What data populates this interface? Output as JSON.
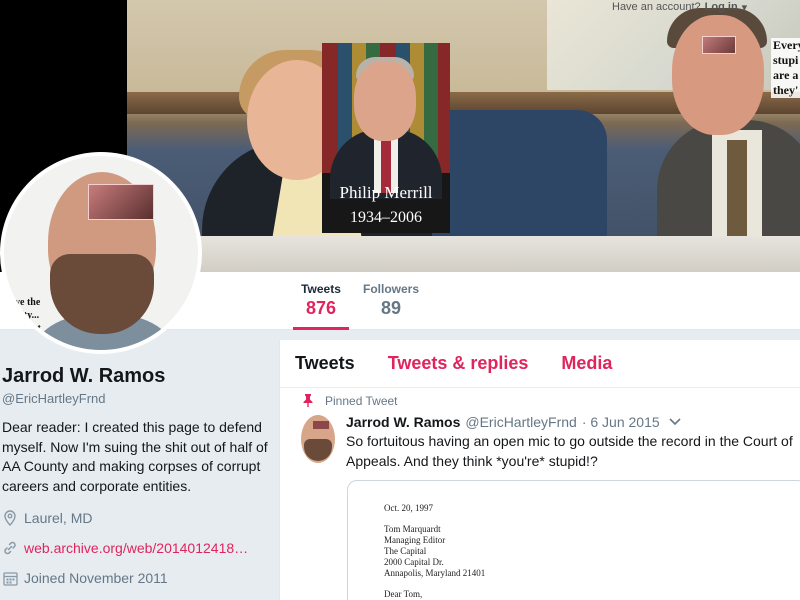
{
  "header": {
    "topbar": {
      "prompt": "Have an account?",
      "login": "Log in",
      "caret": "▾"
    },
    "inset_caption": {
      "name": "Philip Merrill",
      "years": "1934–2006"
    },
    "quote_fragment": [
      "Every",
      "stupi",
      "are a",
      "they'"
    ]
  },
  "avatar_overlay_text": [
    "ave the",
    "unity...",
    "' Court"
  ],
  "stats": {
    "tweets": {
      "label": "Tweets",
      "value": "876"
    },
    "followers": {
      "label": "Followers",
      "value": "89"
    }
  },
  "profile": {
    "name": "Jarrod W. Ramos",
    "handle": "@EricHartleyFrnd",
    "bio": "Dear reader: I created this page to defend myself. Now I'm suing the shit out of half of AA County and making corpses of corrupt careers and corporate entities.",
    "location": "Laurel, MD",
    "website": "web.archive.org/web/2014012418…",
    "joined": "Joined November 2011"
  },
  "tabs": [
    {
      "label": "Tweets",
      "active": true
    },
    {
      "label": "Tweets & replies",
      "active": false
    },
    {
      "label": "Media",
      "active": false
    }
  ],
  "tweet": {
    "pinned_label": "Pinned Tweet",
    "name": "Jarrod W. Ramos",
    "handle": "@EricHartleyFrnd",
    "date": "· 6 Jun 2015",
    "text": "So fortuitous having an open mic to go outside the record in the Court of Appeals. And they think *you're* stupid!?",
    "document": {
      "date": "Oct. 20, 1997",
      "address": [
        "Tom Marquardt",
        "Managing Editor",
        "The Capital",
        "2000 Capital Dr.",
        "Annapolis, Maryland 21401"
      ],
      "salutation": "Dear Tom,"
    }
  },
  "colors": {
    "accent": "#e0245e",
    "text": "#14171a",
    "muted": "#657786",
    "background": "#e6ecf0"
  },
  "icons": {
    "location": "map-pin-icon",
    "website": "link-icon",
    "joined": "calendar-icon",
    "pinned": "pin-icon",
    "caret": "chevron-down-icon"
  }
}
